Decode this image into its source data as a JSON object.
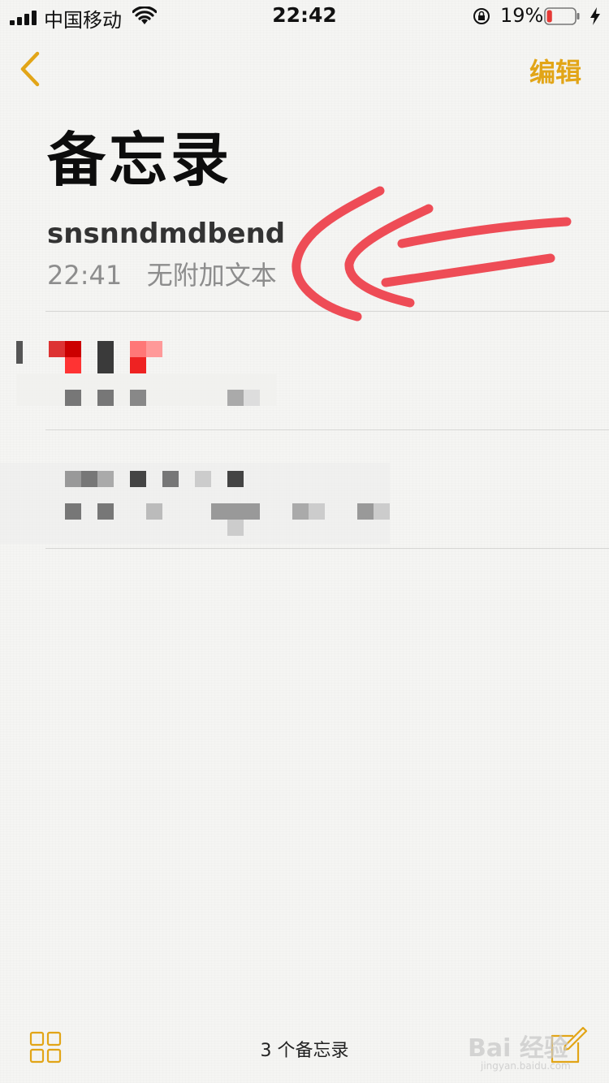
{
  "status_bar": {
    "carrier": "中国移动",
    "time": "22:42",
    "battery_percent": "19%",
    "battery_level": 0.19,
    "battery_color": "#e53935"
  },
  "nav": {
    "back_icon": "chevron-left-icon",
    "edit_label": "编辑",
    "accent_color": "#e2a517"
  },
  "page_title": "备忘录",
  "notes": [
    {
      "title": "snsnndmdbend",
      "time": "22:41",
      "preview": "无附加文本"
    }
  ],
  "toolbar": {
    "count_label": "3 个备忘录",
    "grid_icon": "folders-grid-icon",
    "compose_icon": "compose-icon"
  },
  "watermark": {
    "text": "Bai 经验",
    "sub": "jingyan.baidu.com"
  },
  "annotation_color": "#ee4c56"
}
